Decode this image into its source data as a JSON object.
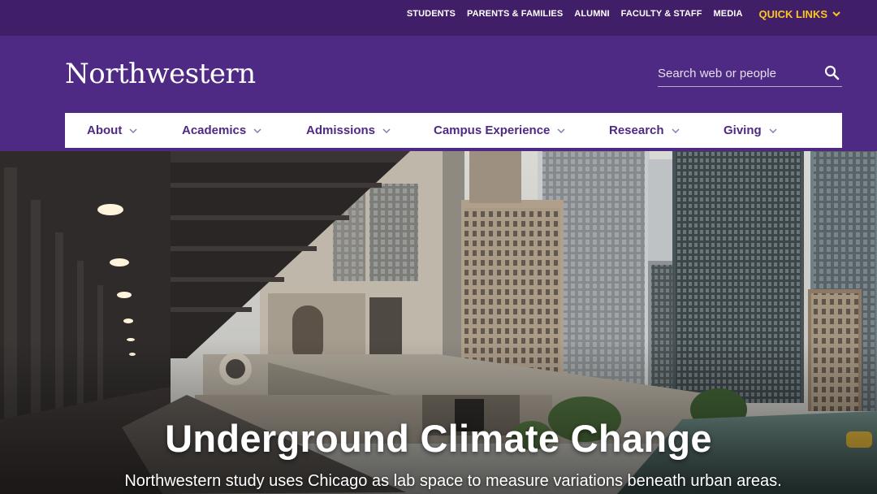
{
  "utility_nav": {
    "links": [
      "STUDENTS",
      "PARENTS & FAMILIES",
      "ALUMNI",
      "FACULTY & STAFF",
      "MEDIA"
    ],
    "quick_links": "QUICK LINKS"
  },
  "brand": {
    "name": "Northwestern"
  },
  "search": {
    "placeholder": "Search web or people"
  },
  "main_nav": {
    "items": [
      "About",
      "Academics",
      "Admissions",
      "Campus Experience",
      "Research",
      "Giving"
    ]
  },
  "hero": {
    "title": "Underground Climate Change",
    "subtitle": "Northwestern study uses Chicago as lab space to measure variations beneath urban areas."
  },
  "colors": {
    "brand_purple": "#4e2a84",
    "utility_purple": "#401f68",
    "accent_gold": "#ffc520"
  }
}
